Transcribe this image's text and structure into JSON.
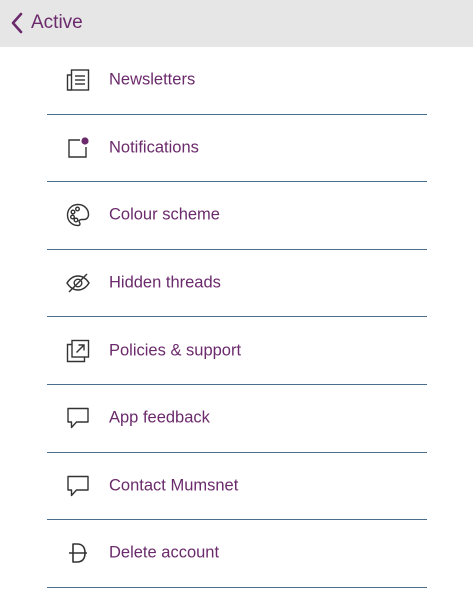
{
  "header": {
    "back_label": "Active",
    "back_icon": "chevron-left-icon"
  },
  "colors": {
    "accent": "#6b2a6b",
    "header_bg": "#e6e6e6",
    "divider": "#4a6e8c"
  },
  "menu": {
    "items": [
      {
        "label": "Newsletters",
        "icon": "newsletter-icon"
      },
      {
        "label": "Notifications",
        "icon": "notification-icon"
      },
      {
        "label": "Colour scheme",
        "icon": "palette-icon"
      },
      {
        "label": "Hidden threads",
        "icon": "eye-hidden-icon"
      },
      {
        "label": "Policies & support",
        "icon": "external-link-icon"
      },
      {
        "label": "App feedback",
        "icon": "speech-bubble-icon"
      },
      {
        "label": "Contact Mumsnet",
        "icon": "speech-bubble-icon"
      },
      {
        "label": "Delete account",
        "icon": "delete-account-icon"
      }
    ]
  }
}
